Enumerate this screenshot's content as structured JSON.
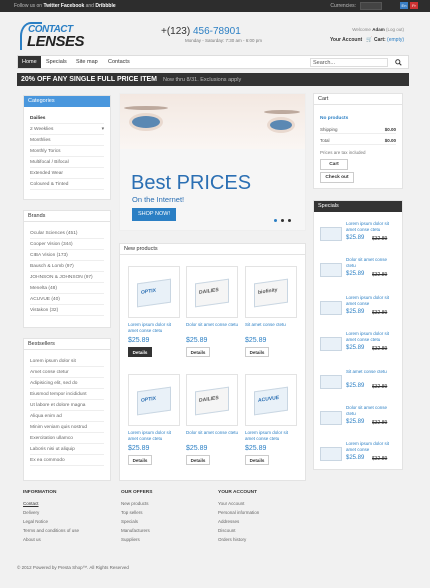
{
  "topbar": {
    "follow_prefix": "Follow us on",
    "twitter": "Twitter",
    "facebook": "Facebook",
    "and": "and",
    "dribbble": "Dribbble",
    "currencies_label": "Currencies:",
    "lang1": "En",
    "lang2": "Fr"
  },
  "header": {
    "logo_top": "CONTACT",
    "logo_bottom": "LENSES",
    "phone_prefix": "+(123)",
    "phone_number": "456-78901",
    "hours": "Monday - Saturday: 7:30 am - 6:00 pm",
    "welcome_prefix": "Welcome",
    "welcome_user": "Adam",
    "welcome_logout": "(Log out)",
    "account": "Your Account",
    "cart_label": "Cart:",
    "cart_state": "(empty)"
  },
  "nav": {
    "items": [
      "Home",
      "Specials",
      "Site map",
      "Contacts"
    ],
    "search_placeholder": "Search..."
  },
  "promo": {
    "headline": "20% OFF ANY SINGLE FULL PRICE ITEM",
    "sub": "Now thru 8/31. Exclusions apply"
  },
  "categories": {
    "title": "Categories",
    "items": [
      "Dailies",
      "2 Weeklies",
      "Monthlies",
      "Monthly Torics",
      "Multifocal / Bifocal",
      "Extended Wear",
      "Coloured & Tinted"
    ]
  },
  "brands": {
    "title": "Brands",
    "items": [
      "Ocular Sciences (451)",
      "Cooper Vision (344)",
      "CIBA Vision (173)",
      "Bausch & Lomb (97)",
      "JOHNSON & JOHNSON (97)",
      "Menelta (48)",
      "ACUVUE (40)",
      "Vistakon (32)"
    ]
  },
  "bestsellers": {
    "title": "Bestsellers",
    "items": [
      "Lorem ipsum dolor sit",
      "Amet conse ctetur",
      "Adipisicing elit, sed do",
      "Eiusmod tempor incididunt",
      "Ut labore et dolore magna",
      "Aliqua enim ad",
      "Minim veniam quis nostrud",
      "Exercitation ullamco",
      "Laboris nisi ut aliquip",
      "Ex ea commodo"
    ]
  },
  "banner": {
    "headline": "Best PRICES",
    "sub": "On the Internet!",
    "button": "SHOP NOW!"
  },
  "new_products": {
    "title": "New products",
    "items": [
      {
        "box": "OPTIX",
        "name": "Lorem ipsum dolor sit amet conse ctetu",
        "price": "$25.89",
        "details": "Details"
      },
      {
        "box": "DAILIES",
        "name": "Dolor sit amet conse ctetu",
        "price": "$25.89",
        "details": "Details"
      },
      {
        "box": "biofinity",
        "name": "Sit amet conse ctetu",
        "price": "$25.89",
        "details": "Details"
      },
      {
        "box": "OPTIX",
        "name": "Lorem ipsum dolor sit amet conse ctetu",
        "price": "$25.89",
        "details": "Details"
      },
      {
        "box": "DAILIES",
        "name": "Dolor sit amet conse ctetu",
        "price": "$25.89",
        "details": "Details"
      },
      {
        "box": "ACUVUE",
        "name": "Lorem ipsum dolor sit amet conse ctetu",
        "price": "$25.89",
        "details": "Details"
      }
    ]
  },
  "cart": {
    "title": "Cart",
    "no_products": "No products",
    "shipping_label": "Shipping",
    "shipping_value": "$0.00",
    "total_label": "Total",
    "total_value": "$0.00",
    "tax_note": "Prices are tax included",
    "cart_button": "Cart",
    "checkout_button": "Check out"
  },
  "specials": {
    "title": "Specials",
    "items": [
      {
        "name": "Lorem ipsum dolor sit amet conse ctetu",
        "price": "$25.89",
        "old": "$32.89"
      },
      {
        "name": "Dolor sit amet conse ctetu",
        "price": "$25.89",
        "old": "$32.89"
      },
      {
        "name": "Lorem ipsum dolor sit amet conse",
        "price": "$25.89",
        "old": "$32.89"
      },
      {
        "name": "Lorem ipsum dolor sit amet conse ctetu",
        "price": "$25.89",
        "old": "$32.89"
      },
      {
        "name": "Sit amet conse ctetu",
        "price": "$25.89",
        "old": "$32.89"
      },
      {
        "name": "Dolor sit amet conse ctetu",
        "price": "$25.89",
        "old": "$32.89"
      },
      {
        "name": "Lorem ipsum dolor sit amet conse",
        "price": "$25.89",
        "old": "$32.89"
      }
    ]
  },
  "footer": {
    "information": {
      "title": "INFORMATION",
      "items": [
        "Contact",
        "Delivery",
        "Legal Notice",
        "Terms and conditions of use",
        "About us"
      ]
    },
    "offers": {
      "title": "OUR OFFERS",
      "items": [
        "New products",
        "Top sellers",
        "Specials",
        "Manufacturers",
        "Suppliers"
      ]
    },
    "account": {
      "title": "YOUR ACCOUNT",
      "items": [
        "Your Account",
        "Personal information",
        "Addresses",
        "Discount",
        "Orders history"
      ]
    },
    "copyright": "© 2012 Powered by Presta Shop™. All Rights Reserved"
  },
  "colors": {
    "accent": "#2b7fc4",
    "dark": "#333333",
    "promo_bg": "#333333"
  }
}
